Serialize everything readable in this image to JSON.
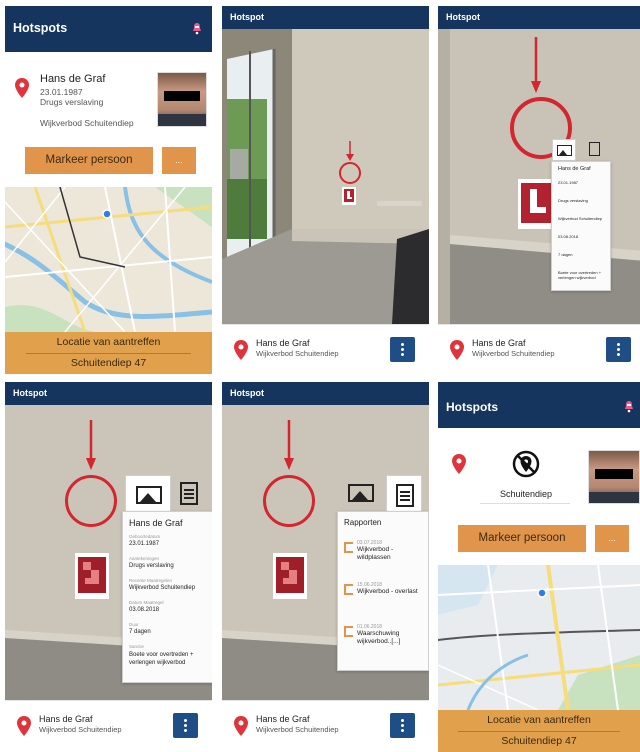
{
  "colors": {
    "header": "#15345e",
    "accent": "#e1954a",
    "pin": "#e0343c",
    "kebab": "#1f4d86"
  },
  "panel1": {
    "title": "Hotspots",
    "person": {
      "name": "Hans de Graf",
      "dob": "23.01.1987",
      "tag": "Drugs verslaving",
      "measure": "Wijkverbod Schuitendiep"
    },
    "mark_button": "Markeer persoon",
    "more_button": "...",
    "location_label": "Locatie van aantreffen",
    "location_value": "Schuitendiep 47"
  },
  "panel2": {
    "title": "Hotspot",
    "bottom": {
      "name": "Hans de Graf",
      "measure": "Wijkverbod Schuitendiep"
    }
  },
  "panel3": {
    "title": "Hotspot",
    "card": {
      "name": "Hans de Graf",
      "fields": [
        "23.01.1987",
        "Drugs verslaving",
        "Wijkverbod Schuitendiep",
        "03.08.2018",
        "7 dagen",
        "Boete voor overtreden + verlengen wijkverbod"
      ]
    },
    "bottom": {
      "name": "Hans de Graf",
      "measure": "Wijkverbod Schuitendiep"
    }
  },
  "panel4": {
    "title": "Hotspot",
    "card": {
      "name": "Hans de Graf",
      "rows": [
        {
          "label": "Geboortedatum",
          "value": "23.01.1987"
        },
        {
          "label": "Aantekeningen",
          "value": "Drugs verslaving"
        },
        {
          "label": "Recente Maatregelen",
          "value": "Wijkverbod Schuitendiep"
        },
        {
          "label": "Datum Maatregel",
          "value": "03.08.2018"
        },
        {
          "label": "Duur",
          "value": "7 dagen"
        },
        {
          "label": "Sanctie",
          "value": "Boete voor overtreden + verlengen wijkverbod"
        }
      ]
    },
    "bottom": {
      "name": "Hans de Graf",
      "measure": "Wijkverbod Schuitendiep"
    }
  },
  "panel5": {
    "title": "Hotspot",
    "reports_title": "Rapporten",
    "reports": [
      {
        "date": "03.07.2018",
        "text": "Wijkverbod - wildplassen"
      },
      {
        "date": "15.06.2018",
        "text": "Wijkverbod - overlast"
      },
      {
        "date": "01.06.2018",
        "text": "Waarschuwing wijkverbod..[...]"
      }
    ],
    "bottom": {
      "name": "Hans de Graf",
      "measure": "Wijkverbod Schuitendiep"
    }
  },
  "panel6": {
    "title": "Hotspots",
    "location_name": "Schuitendiep",
    "mark_button": "Markeer persoon",
    "more_button": "...",
    "location_label": "Locatie van aantreffen",
    "location_value": "Schuitendiep 47"
  },
  "icons": [
    "map-pin-icon",
    "bell-icon",
    "kebab-menu-icon",
    "image-icon",
    "document-icon",
    "arrow-down-icon",
    "no-location-icon"
  ]
}
